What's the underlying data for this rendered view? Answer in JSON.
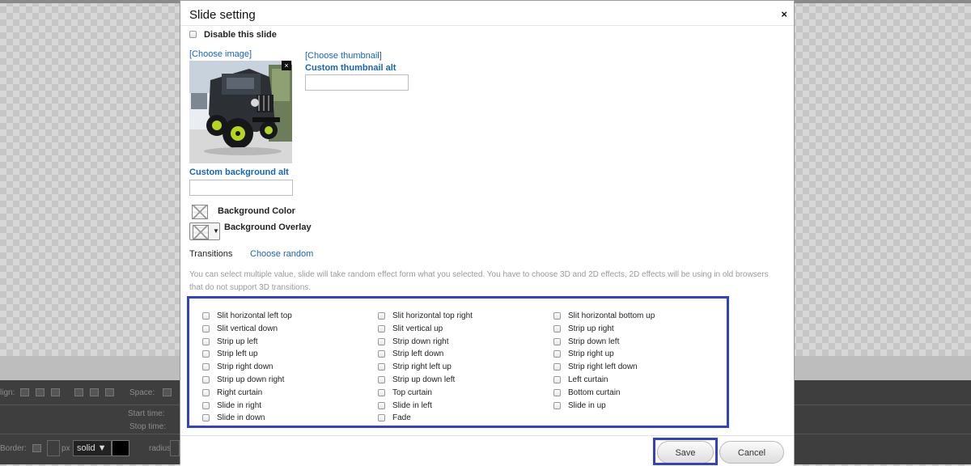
{
  "modal": {
    "title": "Slide setting",
    "close_glyph": "×",
    "disable_label": "Disable this slide",
    "choose_image_link": "[Choose image]",
    "choose_thumbnail_link": "[Choose thumbnail]",
    "custom_thumbnail_alt_label": "Custom thumbnail alt",
    "custom_thumbnail_alt_value": "",
    "custom_background_alt_label": "Custom background alt",
    "custom_background_alt_value": "",
    "background_color_label": "Background Color",
    "background_overlay_label": "Background Overlay",
    "transitions_label": "Transitions",
    "choose_random_link": "Choose random",
    "help_text": "You can select multiple value, slide will take random effect form what you selected. You have to choose 3D and 2D effects, 2D effects will be using in old browsers that do not support 3D transitions.",
    "transitions": [
      [
        "Slit horizontal left top",
        "Slit horizontal top right",
        "Slit horizontal bottom up"
      ],
      [
        "Slit vertical down",
        "Slit vertical up",
        "Strip up right"
      ],
      [
        "Strip up left",
        "Strip down right",
        "Strip down left"
      ],
      [
        "Strip left up",
        "Strip left down",
        "Strip right up"
      ],
      [
        "Strip right down",
        "Strip right left up",
        "Strip right left down"
      ],
      [
        "Strip up down right",
        "Strip up down left",
        "Left curtain"
      ],
      [
        "Right curtain",
        "Top curtain",
        "Bottom curtain"
      ],
      [
        "Slide in right",
        "Slide in left",
        "Slide in up"
      ],
      [
        "Slide in down",
        "Fade",
        ""
      ]
    ],
    "save_label": "Save",
    "cancel_label": "Cancel"
  },
  "background_editor": {
    "align_label": "lign:",
    "space_label": "Space:",
    "start_time_label": "Start time:",
    "stop_time_label": "Stop time:",
    "border_label": "Border:",
    "px_label": "px",
    "border_style": "solid ▼",
    "radius_label": "radius"
  },
  "colors": {
    "accent_link": "#1565c0",
    "highlight_outline": "#3340c8"
  }
}
